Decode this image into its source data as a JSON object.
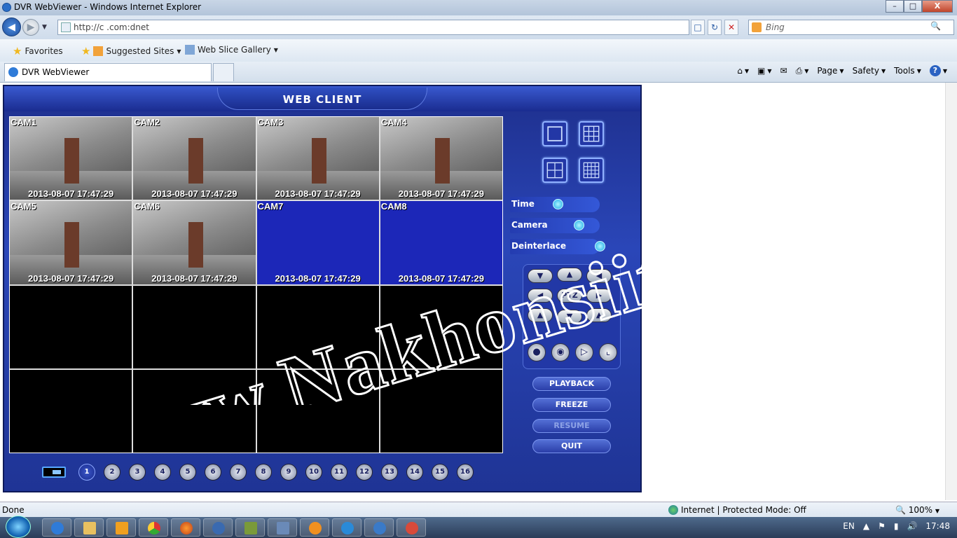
{
  "window": {
    "title": "DVR WebViewer - Windows Internet Explorer",
    "min": "–",
    "max": "□",
    "close": "X"
  },
  "address": {
    "url": "http://c                              .com:dnet",
    "search_placeholder": "Bing"
  },
  "favorites": {
    "favorites_label": "Favorites",
    "suggested_label": "Suggested Sites",
    "webslice_label": "Web Slice Gallery"
  },
  "tab": {
    "label": "DVR WebViewer"
  },
  "commands": {
    "page": "Page",
    "safety": "Safety",
    "tools": "Tools",
    "help": "?"
  },
  "app": {
    "header": "WEB CLIENT",
    "cameras": [
      {
        "label": "CAM1",
        "time": "2013-08-07 17:47:29",
        "state": "video"
      },
      {
        "label": "CAM2",
        "time": "2013-08-07 17:47:29",
        "state": "video"
      },
      {
        "label": "CAM3",
        "time": "2013-08-07 17:47:29",
        "state": "video"
      },
      {
        "label": "CAM4",
        "time": "2013-08-07 17:47:29",
        "state": "video"
      },
      {
        "label": "CAM5",
        "time": "2013-08-07 17:47:29",
        "state": "video"
      },
      {
        "label": "CAM6",
        "time": "2013-08-07 17:47:29",
        "state": "video"
      },
      {
        "label": "CAM7",
        "time": "2013-08-07 17:47:29",
        "state": "blue"
      },
      {
        "label": "CAM8",
        "time": "2013-08-07 17:47:29",
        "state": "blue"
      }
    ],
    "options": {
      "time": "Time",
      "camera": "Camera",
      "deinterlace": "Deinterlace"
    },
    "ptz": {
      "center": "PTZ"
    },
    "actions": {
      "playback": "PLAYBACK",
      "freeze": "FREEZE",
      "resume": "RESUME",
      "quit": "QUIT"
    },
    "channel_numbers": [
      "1",
      "2",
      "3",
      "4",
      "5",
      "6",
      "7",
      "8",
      "9",
      "10",
      "11",
      "12",
      "13",
      "14",
      "15",
      "16"
    ],
    "active_channel": "1"
  },
  "watermark": "www.Nakhonsiit.com",
  "status": {
    "text": "Done",
    "zone": "Internet | Protected Mode: Off",
    "zoom": "100%"
  },
  "taskbar": {
    "language": "EN",
    "clock": "17:48"
  }
}
